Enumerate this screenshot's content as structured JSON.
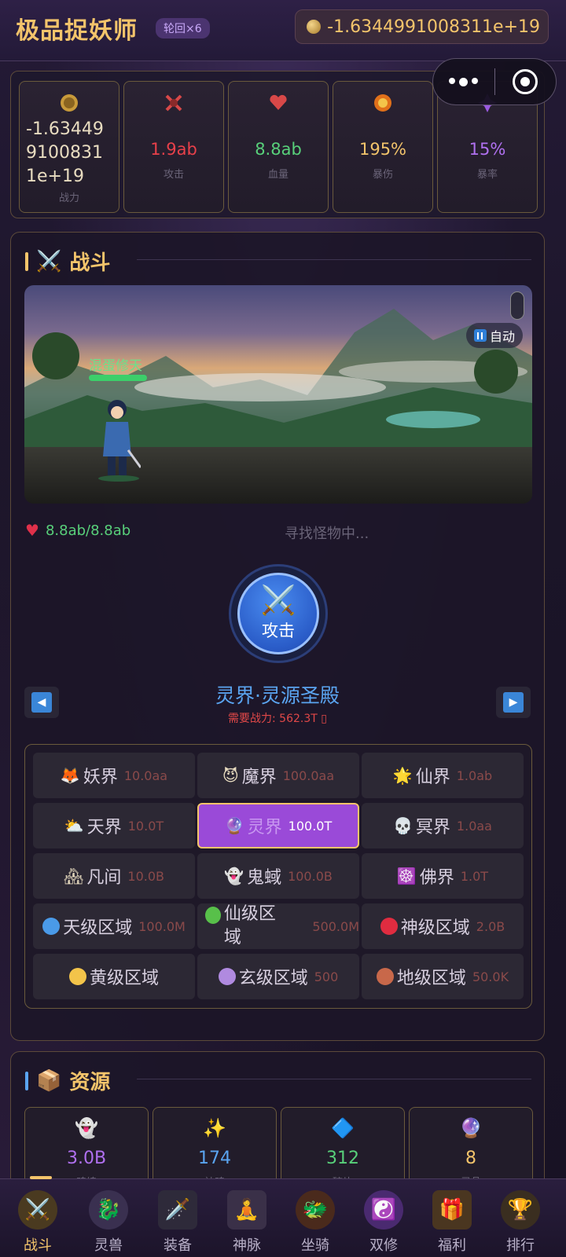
{
  "header": {
    "title": "极品捉妖师",
    "rebirth": "轮回×6",
    "power": "-1.6344991008311e+19"
  },
  "stats": [
    {
      "value": "-1.6344991008311e+19",
      "label": "战力",
      "color": "#e8dcc0",
      "icon": "coin-icon"
    },
    {
      "value": "1.9ab",
      "label": "攻击",
      "color": "#e8404a",
      "icon": "attack-icon"
    },
    {
      "value": "8.8ab",
      "label": "血量",
      "color": "#58d07a",
      "icon": "hp-icon"
    },
    {
      "value": "195%",
      "label": "暴伤",
      "color": "#f3c46b",
      "icon": "crit-damage-icon"
    },
    {
      "value": "15%",
      "label": "暴率",
      "color": "#b070f0",
      "icon": "crit-rate-icon"
    }
  ],
  "battle": {
    "section_title": "战斗",
    "section_emoji": "⚔️",
    "auto_label": "自动",
    "hero_name": "混蛋修天",
    "hp": "8.8ab/8.8ab",
    "status": "寻找怪物中...",
    "attack_label": "攻击",
    "realm_name": "灵界·灵源圣殿",
    "realm_req": "需要战力: 562.3T ▯"
  },
  "zones": [
    {
      "icon": "🦊",
      "name": "妖界",
      "req": "10.0aa",
      "active": false
    },
    {
      "icon": "😈",
      "name": "魔界",
      "req": "100.0aa",
      "active": false
    },
    {
      "icon": "🌟",
      "name": "仙界",
      "req": "1.0ab",
      "active": false
    },
    {
      "icon": "⛅",
      "name": "天界",
      "req": "10.0T",
      "active": false
    },
    {
      "icon": "🔮",
      "name": "灵界",
      "req": "100.0T",
      "active": true
    },
    {
      "icon": "💀",
      "name": "冥界",
      "req": "1.0aa",
      "active": false
    },
    {
      "icon": "🏘",
      "name": "凡间",
      "req": "10.0B",
      "active": false
    },
    {
      "icon": "👻",
      "name": "鬼蜮",
      "req": "100.0B",
      "active": false
    },
    {
      "icon": "☸️",
      "name": "佛界",
      "req": "1.0T",
      "active": false
    },
    {
      "dot": "#4a9ae8",
      "name": "天级区域",
      "req": "100.0M",
      "active": false
    },
    {
      "dot": "#58c04a",
      "name": "仙级区域",
      "req": "500.0M",
      "active": false,
      "wrap": true
    },
    {
      "dot": "#e02c40",
      "name": "神级区域",
      "req": "2.0B",
      "active": false
    },
    {
      "dot": "#f3c44a",
      "name": "黄级区域",
      "req": "",
      "active": false
    },
    {
      "dot": "#b08ae0",
      "name": "玄级区域",
      "req": "500",
      "active": false
    },
    {
      "dot": "#c8684a",
      "name": "地级区域",
      "req": "50.0K",
      "active": false
    }
  ],
  "resources": {
    "section_title": "资源",
    "section_emoji": "📦",
    "items": [
      {
        "icon": "👻",
        "value": "3.0B",
        "label": "魂魄",
        "color": "#b070f0"
      },
      {
        "icon": "✨",
        "value": "174",
        "label": "神魂",
        "color": "#5aa4f0"
      },
      {
        "icon": "🔷",
        "value": "312",
        "label": "碎片",
        "color": "#58d07a"
      },
      {
        "icon": "🔮",
        "value": "8",
        "label": "灵晶",
        "color": "#f3c46b"
      }
    ]
  },
  "nav": [
    {
      "label": "战斗",
      "icon": "⚔️",
      "active": true
    },
    {
      "label": "灵兽",
      "icon": "🐉",
      "active": false
    },
    {
      "label": "装备",
      "icon": "🗡️",
      "active": false
    },
    {
      "label": "神脉",
      "icon": "🧘",
      "active": false
    },
    {
      "label": "坐骑",
      "icon": "🐲",
      "active": false
    },
    {
      "label": "双修",
      "icon": "☯️",
      "active": false
    },
    {
      "label": "福利",
      "icon": "🎁",
      "active": false
    },
    {
      "label": "排行",
      "icon": "🏆",
      "active": false
    }
  ]
}
